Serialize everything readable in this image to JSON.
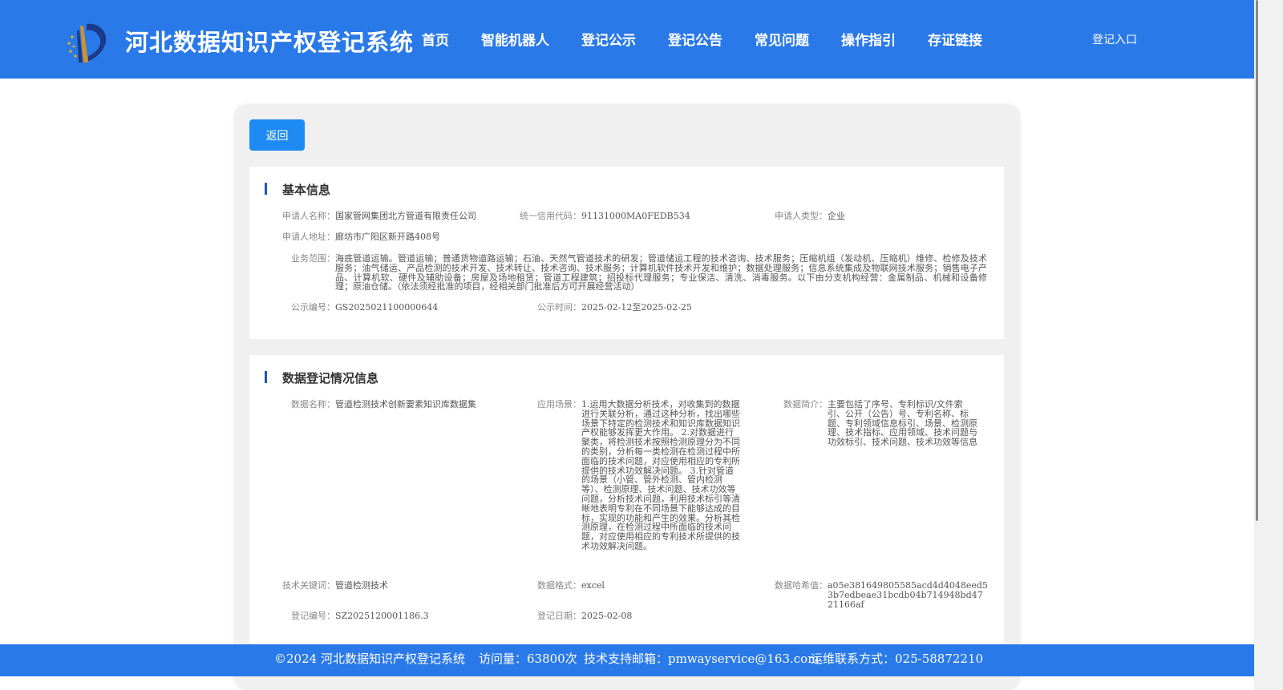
{
  "header": {
    "site_title": "河北数据知识产权登记系统",
    "nav": [
      "首页",
      "智能机器人",
      "登记公示",
      "登记公告",
      "常见问题",
      "操作指引",
      "存证链接"
    ],
    "login": "登记入口"
  },
  "back_button": "返回",
  "basic": {
    "title": "基本信息",
    "applicant_name_label": "申请人名称：",
    "applicant_name": "国家管网集团北方管道有限责任公司",
    "credit_code_label": "统一信用代码：",
    "credit_code": "91131000MA0FEDB534",
    "applicant_type_label": "申请人类型：",
    "applicant_type": "企业",
    "address_label": "申请人地址：",
    "address": "廊坊市广阳区新开路408号",
    "scope_label": "业务范围：",
    "scope": "海底管道运输。管道运输；普通货物道路运输；石油、天然气管道技术的研发；管道储运工程的技术咨询、技术服务；压缩机组（发动机、压缩机）维修、检修及技术服务；油气储运、产品检测的技术开发、技术转让、技术咨询、技术服务；计算机软件技术开发和维护；数据处理服务；信息系统集成及物联网技术服务；销售电子产品、计算机软、硬件及辅助设备；房屋及场地租赁；管道工程建筑；招投标代理服务；专业保洁、清洗、消毒服务。以下由分支机构经营：金属制品、机械和设备修理；原油仓储。（依法须经批准的项目，经相关部门批准后方可开展经营活动）",
    "pub_no_label": "公示编号：",
    "pub_no": "GS2025021100000644",
    "pub_time_label": "公示时间：",
    "pub_time": "2025-02-12至2025-02-25"
  },
  "data": {
    "title": "数据登记情况信息",
    "name_label": "数据名称：",
    "name": "管道检测技术创新要素知识库数据集",
    "scene_label": "应用场景：",
    "scene": "1.运用大数据分析技术，对收集到的数据进行关联分析，通过这种分析，找出哪些场景下特定的检测技术和知识库数据知识产权能够发挥更大作用。 2.对数据进行聚类，将检测技术按照检测原理分为不同的类别，分析每一类检测在检测过程中所面临的技术问题，对应使用相应的专利所提供的技术功效解决问题。 3.针对管道的场景（小管、管外检测、管内检测等）、检测原理、技术问题、技术功效等问题，分析技术问题，利用技术标引等清晰地表明专利在不同场景下能够达成的目标，实现的功能和产生的效果。分析其检测原理，在检测过程中所面临的技术问题，对应使用相应的专利技术所提供的技术功效解决问题。",
    "intro_label": "数据简介：",
    "intro": "主要包括了序号、专利标识/文件索引、公开（公告）号、专利名称、标题、专利领域信息标引、场景、检测原理、技术指标、应用领域、技术问题与功效标引、技术问题、技术功效等信息",
    "keywords_label": "技术关键词：",
    "keywords": "管道检测技术",
    "format_label": "数据格式：",
    "format": "excel",
    "hash_label": "数据哈希值：",
    "hash": "a05e381649805585acd4d4048eed53b7edbeae31bcdb04b714948bd4721166af",
    "reg_no_label": "登记编号：",
    "reg_no": "SZ2025120001186.3",
    "reg_date_label": "登记日期：",
    "reg_date": "2025-02-08"
  },
  "footer": {
    "copyright": "©2024 河北数据知识产权登记系统",
    "visits": "访问量：63800次",
    "email": "技术支持邮箱：pmwayservice@163.com",
    "phone": "运维联系方式：025-58872210"
  },
  "colors": {
    "primary": "#2a79e8",
    "button": "#1e8bf5",
    "accent_bar": "#1e5ab6"
  }
}
